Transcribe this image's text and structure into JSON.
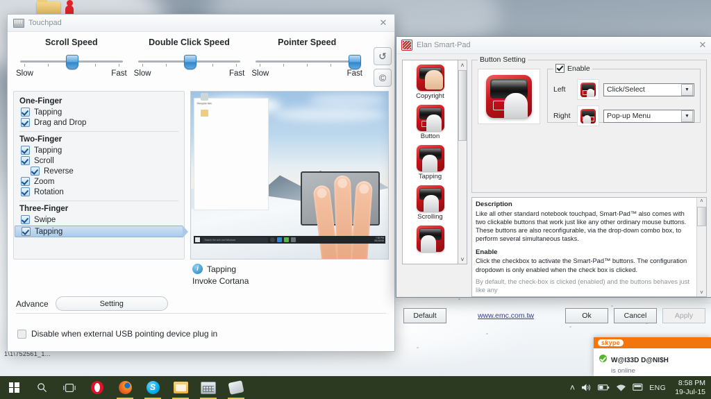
{
  "desktop": {
    "icons": [
      {
        "name": "folder-icon",
        "label": ""
      },
      {
        "name": "partial-icon",
        "label": "1\\1\\752561_1..."
      }
    ]
  },
  "touchpad_window": {
    "title": "Touchpad",
    "icon": "touchpad-icon",
    "close_label": "✕",
    "sliders": [
      {
        "name": "scroll-speed",
        "title": "Scroll Speed",
        "min_label": "Slow",
        "max_label": "Fast",
        "value_pct": 50
      },
      {
        "name": "double-click-speed",
        "title": "Double Click Speed",
        "min_label": "Slow",
        "max_label": "Fast",
        "value_pct": 50
      },
      {
        "name": "pointer-speed",
        "title": "Pointer Speed",
        "min_label": "Slow",
        "max_label": "Fast",
        "value_pct": 97
      }
    ],
    "side_buttons": [
      {
        "name": "reset-button",
        "glyph": "↺"
      },
      {
        "name": "copyright-button",
        "glyph": "©"
      }
    ],
    "groups": [
      {
        "title": "One-Finger",
        "items": [
          {
            "label": "Tapping",
            "checked": true,
            "indent": false,
            "selected": false
          },
          {
            "label": "Drag and Drop",
            "checked": true,
            "indent": false,
            "selected": false
          }
        ]
      },
      {
        "title": "Two-Finger",
        "items": [
          {
            "label": "Tapping",
            "checked": true,
            "indent": false,
            "selected": false
          },
          {
            "label": "Scroll",
            "checked": true,
            "indent": false,
            "selected": false
          },
          {
            "label": "Reverse",
            "checked": true,
            "indent": true,
            "selected": false
          },
          {
            "label": "Zoom",
            "checked": true,
            "indent": false,
            "selected": false
          },
          {
            "label": "Rotation",
            "checked": true,
            "indent": false,
            "selected": false
          }
        ]
      },
      {
        "title": "Three-Finger",
        "items": [
          {
            "label": "Swipe",
            "checked": true,
            "indent": false,
            "selected": false
          },
          {
            "label": "Tapping",
            "checked": true,
            "indent": false,
            "selected": true
          }
        ]
      }
    ],
    "preview": {
      "name": "gesture-preview-video",
      "taskbar_search_placeholder": "Search the web and Windows",
      "clock_time": "7:00 PM",
      "clock_date": "3/11/2015"
    },
    "info": {
      "icon": "info-icon",
      "title": "Tapping",
      "subtitle": "Invoke Cortana"
    },
    "advance_label": "Advance",
    "setting_button": "Setting",
    "disable_usb": {
      "label": "Disable when external USB pointing device plug in",
      "checked": false
    }
  },
  "elan_window": {
    "title": "Elan Smart-Pad",
    "icon": "elan-logo-icon",
    "close_label": "✕",
    "nav_items": [
      {
        "label": "Copyright",
        "icon": "copyright-nav-icon"
      },
      {
        "label": "Button",
        "icon": "button-nav-icon"
      },
      {
        "label": "Tapping",
        "icon": "tapping-nav-icon"
      },
      {
        "label": "Scrolling",
        "icon": "scrolling-nav-icon"
      },
      {
        "label": "",
        "icon": "more-nav-icon"
      }
    ],
    "nav_scroll": {
      "up": "˄",
      "down": "˅"
    },
    "fieldset_legend": "Button Setting",
    "preview_icon": "button-preview-icon",
    "enable": {
      "label": "Enable",
      "checked": true
    },
    "buttons": [
      {
        "name": "left-button-setting",
        "label": "Left",
        "icon": "left-button-icon",
        "value": "Click/Select"
      },
      {
        "name": "right-button-setting",
        "label": "Right",
        "icon": "right-button-icon",
        "value": "Pop-up Menu"
      }
    ],
    "description": {
      "h1": "Description",
      "p1": "Like all other standard notebook touchpad, Smart-Pad™ also comes with two clickable buttons that work just like any other ordinary mouse buttons. These buttons are also reconfigurable, via the drop-down combo box, to perform several simultaneous tasks.",
      "h2": "Enable",
      "p2": "Click the checkbox to activate the Smart-Pad™ buttons. The configuration dropdown is only enabled when the check box is clicked.",
      "p3": "By default, the check-box is clicked (enabled) and the buttons behaves just like any",
      "scroll_up": "˄",
      "scroll_down": "˅"
    },
    "footer": {
      "default_label": "Default",
      "link": "www.emc.com.tw",
      "ok_label": "Ok",
      "cancel_label": "Cancel",
      "apply_label": "Apply",
      "apply_disabled": true
    }
  },
  "skype_toast": {
    "brand": "skype",
    "user": "W@I33D D@NI$H",
    "status": "is online"
  },
  "taskbar": {
    "items": [
      {
        "name": "start-button",
        "icon": "windows-logo-icon",
        "running": false
      },
      {
        "name": "search-button",
        "icon": "search-icon",
        "running": false
      },
      {
        "name": "task-view-button",
        "icon": "task-view-icon",
        "running": false
      },
      {
        "name": "opera-button",
        "icon": "opera-icon",
        "running": false
      },
      {
        "name": "firefox-button",
        "icon": "firefox-icon",
        "running": true
      },
      {
        "name": "skype-button",
        "icon": "skype-icon",
        "running": true
      },
      {
        "name": "explorer-button",
        "icon": "file-explorer-icon",
        "running": true
      },
      {
        "name": "calculator-button",
        "icon": "calculator-icon",
        "running": true
      },
      {
        "name": "touchpad-button",
        "icon": "touchpad-tray-icon",
        "running": true
      }
    ],
    "tray": [
      {
        "name": "show-hidden-icons",
        "glyph": "˄"
      },
      {
        "name": "volume-icon",
        "glyph": "🔊"
      },
      {
        "name": "battery-icon",
        "glyph": "▭"
      },
      {
        "name": "wifi-icon",
        "glyph": "◠"
      },
      {
        "name": "action-center-icon",
        "glyph": "▤"
      },
      {
        "name": "language-indicator",
        "glyph": "ENG"
      }
    ],
    "clock": {
      "time": "8:58 PM",
      "date": "19-Jul-15"
    }
  },
  "colors": {
    "accent_red": "#c4131a",
    "skype_orange": "#f3750b",
    "taskbar": "#2b3a21",
    "selection_blue": "#a9cbe9"
  }
}
